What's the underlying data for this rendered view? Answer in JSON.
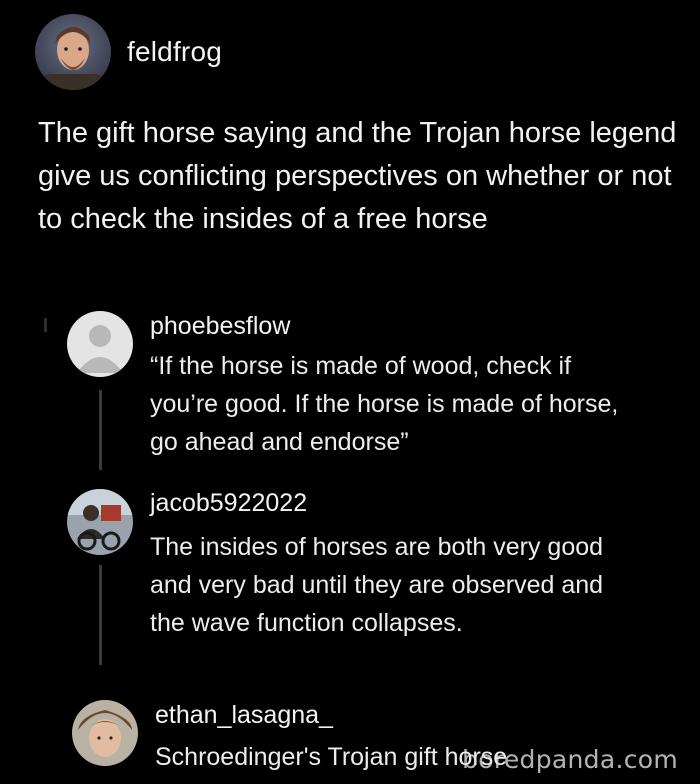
{
  "post": {
    "username": "feldfrog",
    "text": "The gift horse saying and the Trojan horse legend give us conflicting perspectives on whether or not to check the insides of a free horse"
  },
  "replies": [
    {
      "username": "phoebesflow",
      "text": "“If the horse is made of wood, check if you’re good. If the horse is made of horse, go ahead and endorse”",
      "avatar": "default-user-icon"
    },
    {
      "username": "jacob5922022",
      "text": "The insides of horses are both very good and very bad until they are observed and the wave function collapses.",
      "avatar": "user-photo"
    },
    {
      "username": "ethan_lasagna_",
      "text": "Schroedinger's Trojan gift horse",
      "avatar": "user-photo"
    }
  ],
  "watermark": "boredpanda.com",
  "colors": {
    "background": "#000000",
    "text": "#f2f2f2",
    "thread_line": "#3a3a3a"
  }
}
